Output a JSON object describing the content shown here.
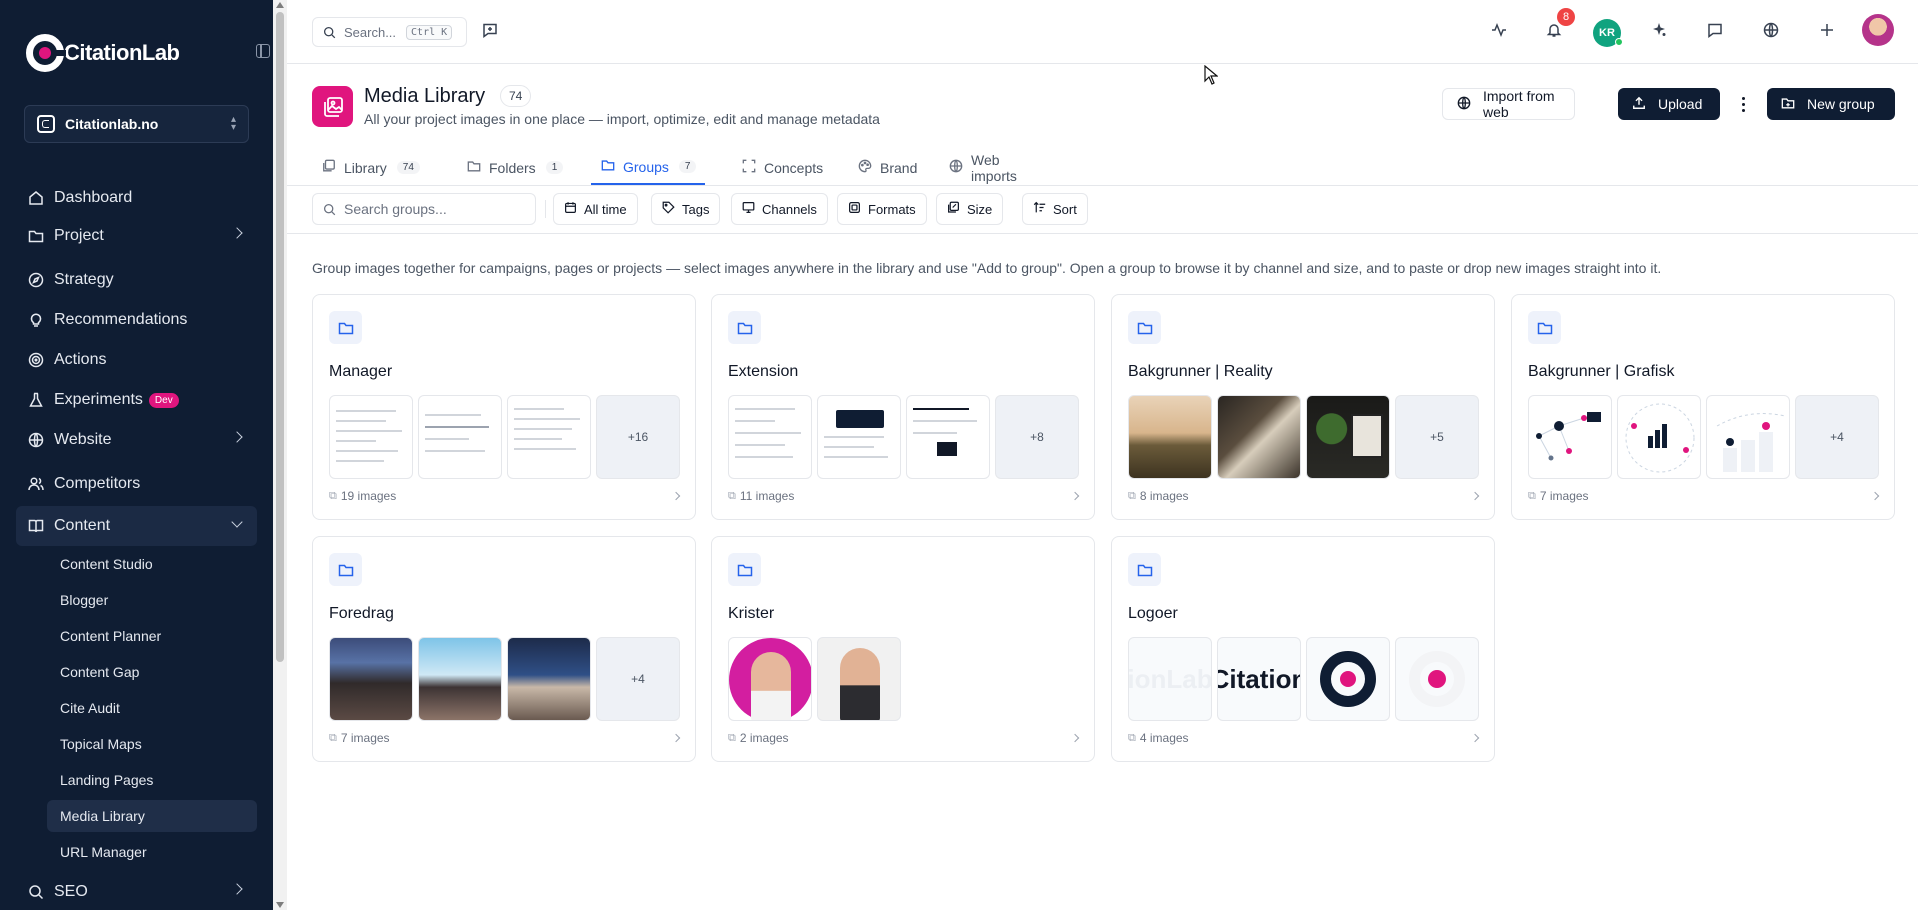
{
  "brand": {
    "name": "CitationLab"
  },
  "workspace": {
    "name": "Citationlab.no"
  },
  "sidebar": {
    "items": [
      {
        "label": "Dashboard",
        "icon": "home-icon"
      },
      {
        "label": "Project",
        "icon": "folder-icon"
      },
      {
        "label": "Strategy",
        "icon": "compass-icon"
      },
      {
        "label": "Recommendations",
        "icon": "lightbulb-icon"
      },
      {
        "label": "Actions",
        "icon": "target-icon"
      },
      {
        "label": "Experiments",
        "icon": "flask-icon",
        "badge": "Dev"
      },
      {
        "label": "Website",
        "icon": "globe-icon"
      },
      {
        "label": "Competitors",
        "icon": "users-icon"
      },
      {
        "label": "Content",
        "icon": "book-icon"
      },
      {
        "label": "SEO",
        "icon": "search-icon"
      }
    ],
    "content_sub": [
      "Content Studio",
      "Blogger",
      "Content Planner",
      "Content Gap",
      "Cite Audit",
      "Topical Maps",
      "Landing Pages",
      "Media Library",
      "URL Manager"
    ]
  },
  "topbar": {
    "search_placeholder": "Search...",
    "shortcut": "Ctrl K",
    "notifications": "8",
    "user_initials": "KR"
  },
  "header": {
    "title": "Media Library",
    "count": "74",
    "subtitle": "All your project images in one place — import, optimize, edit and manage metadata",
    "import_label": "Import from web",
    "upload_label": "Upload",
    "new_group_label": "New group"
  },
  "tabs": [
    {
      "label": "Library",
      "count": "74"
    },
    {
      "label": "Folders",
      "count": "1"
    },
    {
      "label": "Groups",
      "count": "7"
    },
    {
      "label": "Concepts",
      "count": null
    },
    {
      "label": "Brand",
      "count": null
    },
    {
      "label": "Web imports",
      "count": null
    }
  ],
  "filters": {
    "search_placeholder": "Search groups...",
    "buttons": [
      "All time",
      "Tags",
      "Channels",
      "Formats",
      "Size",
      "Sort"
    ]
  },
  "help_text": "Group images together for campaigns, pages or projects — select images anywhere in the library and use \"Add to group\". Open a group to browse it by channel and size, and to paste or drop new images straight into it.",
  "groups": [
    {
      "name": "Manager",
      "more": "+16",
      "count": "19 images"
    },
    {
      "name": "Extension",
      "more": "+8",
      "count": "11 images"
    },
    {
      "name": "Bakgrunner | Reality",
      "more": "+5",
      "count": "8 images"
    },
    {
      "name": "Bakgrunner | Grafisk",
      "more": "+4",
      "count": "7 images"
    },
    {
      "name": "Foredrag",
      "more": "+4",
      "count": "7 images"
    },
    {
      "name": "Krister",
      "more": null,
      "count": "2 images"
    },
    {
      "name": "Logoer",
      "more": null,
      "count": "4 images",
      "logo_texts": [
        "ionLab",
        "Citation"
      ]
    }
  ],
  "colors": {
    "sidebar_bg": "#0f1d33",
    "accent": "#e0157e",
    "link": "#2563eb"
  }
}
